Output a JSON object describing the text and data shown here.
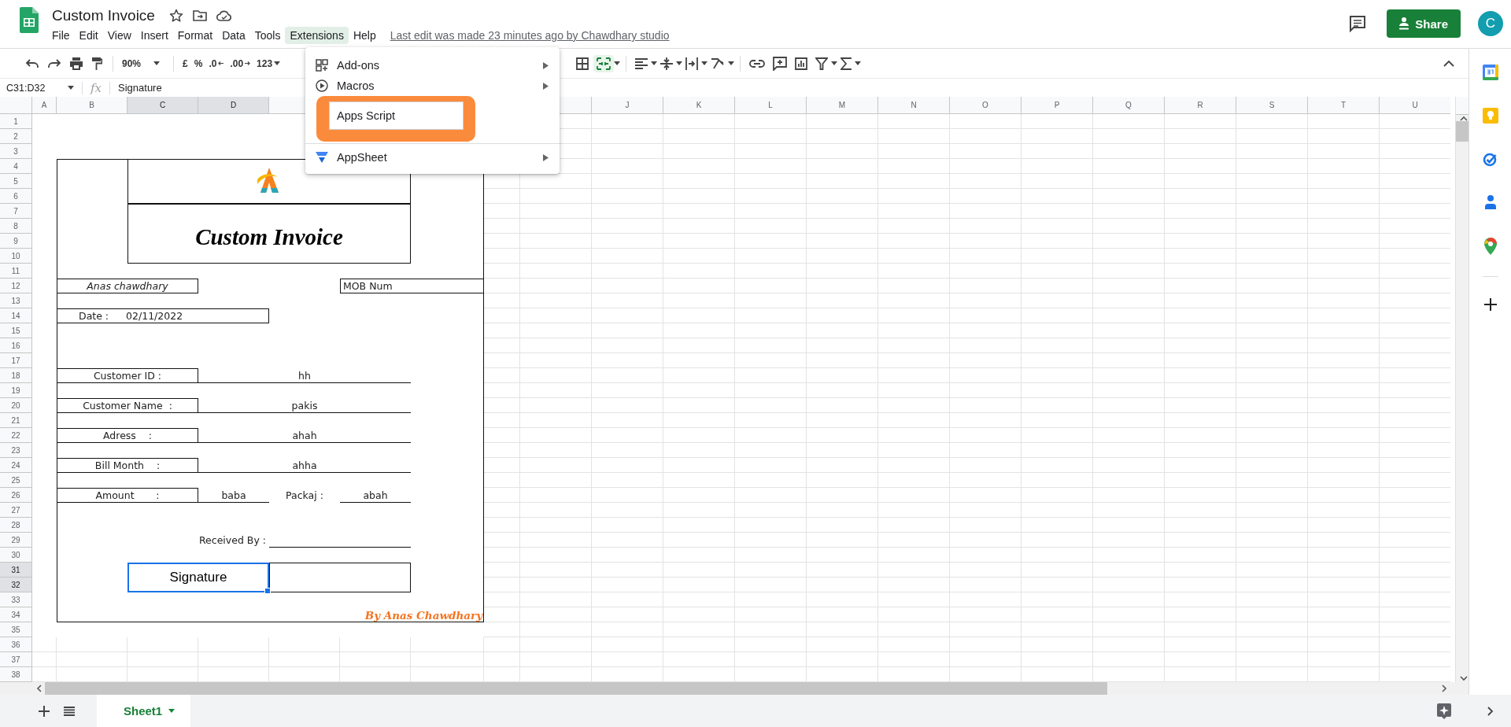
{
  "document": {
    "title": "Custom Invoice",
    "last_edit": "Last edit was made 23 minutes ago by Chawdhary studio"
  },
  "menu_bar": [
    {
      "label": "File",
      "selected": false
    },
    {
      "label": "Edit",
      "selected": false
    },
    {
      "label": "View",
      "selected": false
    },
    {
      "label": "Insert",
      "selected": false
    },
    {
      "label": "Format",
      "selected": false
    },
    {
      "label": "Data",
      "selected": false
    },
    {
      "label": "Tools",
      "selected": false
    },
    {
      "label": "Extensions",
      "selected": true
    },
    {
      "label": "Help",
      "selected": false
    }
  ],
  "share_button": "Share",
  "avatar": "C",
  "toolbar": {
    "zoom": "90%",
    "currency": "£",
    "percent": "%",
    "decimal_decrease": ".0",
    "decimal_increase": ".00",
    "number_format": "123",
    "merge_selected": true
  },
  "formula_bar": {
    "name_box": "C31:D32",
    "function_label": "fx",
    "value": "Signature"
  },
  "column_headers": {
    "left": [
      {
        "label": "A",
        "selected": false
      },
      {
        "label": "B",
        "selected": false
      },
      {
        "label": "C",
        "selected": true
      },
      {
        "label": "D",
        "selected": true
      }
    ],
    "right": [
      {
        "label": "J",
        "selected": false
      },
      {
        "label": "K",
        "selected": false
      },
      {
        "label": "L",
        "selected": false
      },
      {
        "label": "M",
        "selected": false
      },
      {
        "label": "N",
        "selected": false
      },
      {
        "label": "O",
        "selected": false
      },
      {
        "label": "P",
        "selected": false
      },
      {
        "label": "Q",
        "selected": false
      },
      {
        "label": "R",
        "selected": false
      },
      {
        "label": "S",
        "selected": false
      },
      {
        "label": "T",
        "selected": false
      },
      {
        "label": "U",
        "selected": false
      }
    ]
  },
  "row_headers": [
    {
      "label": "1",
      "selected": false
    },
    {
      "label": "2",
      "selected": false
    },
    {
      "label": "3",
      "selected": false
    },
    {
      "label": "4",
      "selected": false
    },
    {
      "label": "5",
      "selected": false
    },
    {
      "label": "6",
      "selected": false
    },
    {
      "label": "7",
      "selected": false
    },
    {
      "label": "8",
      "selected": false
    },
    {
      "label": "9",
      "selected": false
    },
    {
      "label": "10",
      "selected": false
    },
    {
      "label": "11",
      "selected": false
    },
    {
      "label": "12",
      "selected": false
    },
    {
      "label": "13",
      "selected": false
    },
    {
      "label": "14",
      "selected": false
    },
    {
      "label": "15",
      "selected": false
    },
    {
      "label": "16",
      "selected": false
    },
    {
      "label": "17",
      "selected": false
    },
    {
      "label": "18",
      "selected": false
    },
    {
      "label": "19",
      "selected": false
    },
    {
      "label": "20",
      "selected": false
    },
    {
      "label": "21",
      "selected": false
    },
    {
      "label": "22",
      "selected": false
    },
    {
      "label": "23",
      "selected": false
    },
    {
      "label": "24",
      "selected": false
    },
    {
      "label": "25",
      "selected": false
    },
    {
      "label": "26",
      "selected": false
    },
    {
      "label": "27",
      "selected": false
    },
    {
      "label": "28",
      "selected": false
    },
    {
      "label": "29",
      "selected": false
    },
    {
      "label": "30",
      "selected": false
    },
    {
      "label": "31",
      "selected": true
    },
    {
      "label": "32",
      "selected": true
    },
    {
      "label": "33",
      "selected": false
    },
    {
      "label": "34",
      "selected": false
    },
    {
      "label": "35",
      "selected": false
    },
    {
      "label": "36",
      "selected": false
    },
    {
      "label": "37",
      "selected": false
    },
    {
      "label": "38",
      "selected": false
    }
  ],
  "invoice": {
    "title": "Custom Invoice",
    "name": "Anas chawdhary",
    "mobile_label": "MOB Num",
    "date_label": "Date :",
    "date": "02/11/2022",
    "fields": [
      {
        "label": "Customer ID :",
        "value": "hh"
      },
      {
        "label": "Customer Name  :",
        "value": "pakis"
      },
      {
        "label": "Adress    :",
        "value": "ahah"
      },
      {
        "label": "Bill Month    :",
        "value": "ahha"
      }
    ],
    "amount": {
      "label": "Amount       :",
      "value": "baba",
      "package_label": "Packaj :",
      "package_value": "abah"
    },
    "received_by": "Received By :",
    "signature": "Signature",
    "signature_selected": true,
    "credit": "By Anas Chawdhary"
  },
  "extensions_menu": [
    {
      "label": "Add-ons",
      "kind": "submenu",
      "highlighted": false
    },
    {
      "label": "Macros",
      "kind": "submenu",
      "highlighted": false
    },
    {
      "label": "Apps Script",
      "kind": "item",
      "highlighted": true
    },
    {
      "kind": "separator"
    },
    {
      "label": "AppSheet",
      "kind": "submenu",
      "highlighted": false
    }
  ],
  "sheet_tabs": [
    {
      "label": "Sheet1",
      "selected": true
    }
  ]
}
